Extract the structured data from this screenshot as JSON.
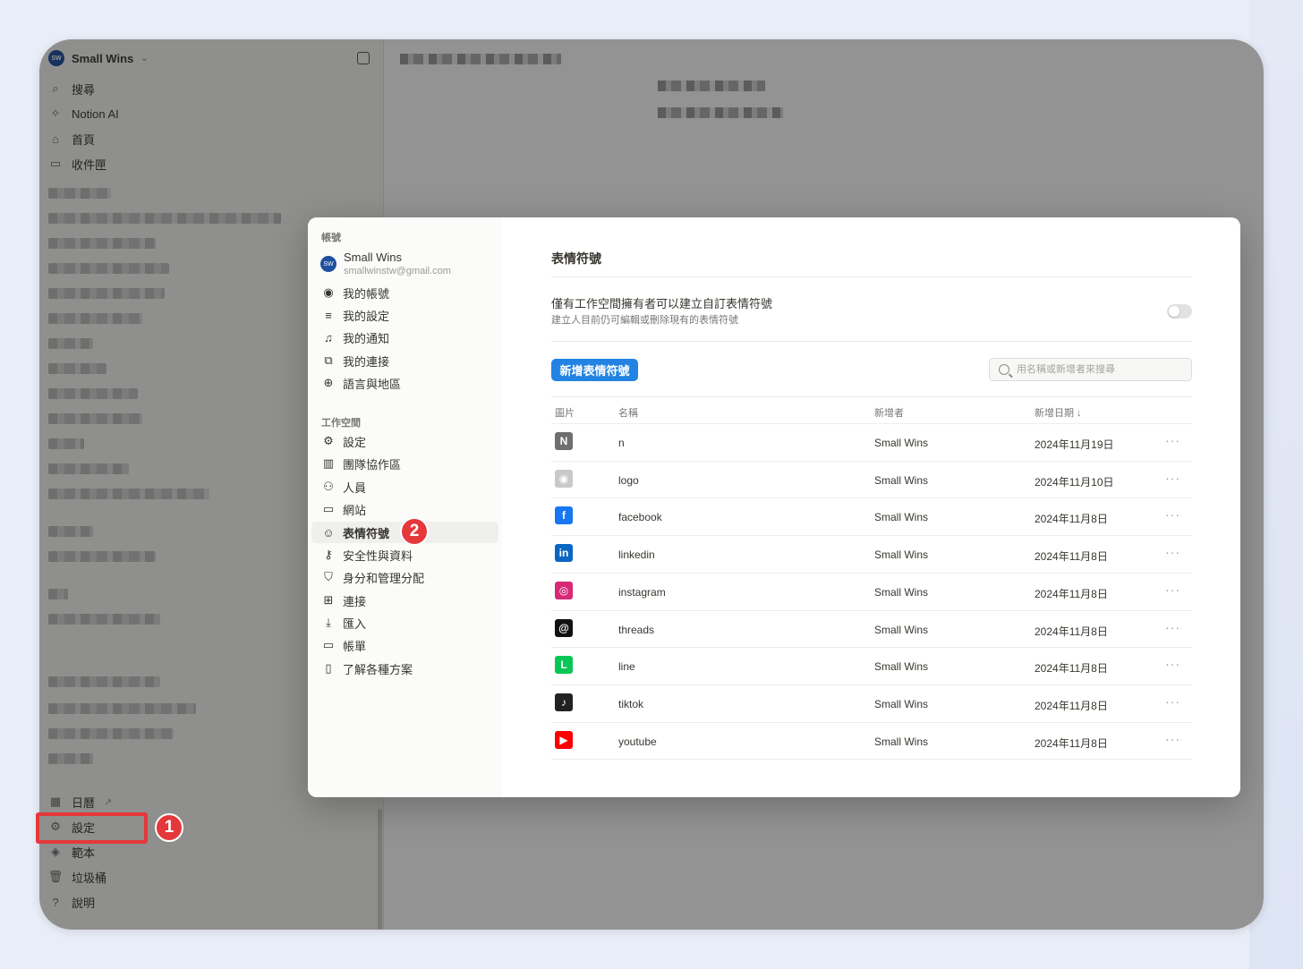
{
  "workspace": {
    "name": "Small Wins",
    "avatar_text": "SW"
  },
  "sidebar": {
    "top_items": [
      {
        "label": "搜尋",
        "icon": "search-icon"
      },
      {
        "label": "Notion AI",
        "icon": "notion-ai-icon"
      },
      {
        "label": "首頁",
        "icon": "home-icon"
      },
      {
        "label": "收件匣",
        "icon": "inbox-icon"
      }
    ],
    "bottom_items": [
      {
        "label": "日曆",
        "icon": "calendar-icon"
      },
      {
        "label": "設定",
        "icon": "gear-icon"
      },
      {
        "label": "範本",
        "icon": "template-icon"
      },
      {
        "label": "垃圾桶",
        "icon": "trash-icon"
      },
      {
        "label": "說明",
        "icon": "help-icon"
      }
    ],
    "calendar_arrow": "↗"
  },
  "annotations": {
    "step1": "1",
    "step2": "2"
  },
  "settings_modal": {
    "account_section": "帳號",
    "account": {
      "name": "Small Wins",
      "email": "smallwinstw@gmail.com"
    },
    "account_items": [
      {
        "label": "我的帳號",
        "icon": "user-circle-icon"
      },
      {
        "label": "我的設定",
        "icon": "sliders-icon"
      },
      {
        "label": "我的通知",
        "icon": "bell-icon"
      },
      {
        "label": "我的連接",
        "icon": "external-link-icon"
      },
      {
        "label": "語言與地區",
        "icon": "globe-icon"
      }
    ],
    "workspace_section": "工作空間",
    "workspace_items": [
      {
        "label": "設定",
        "icon": "gear-icon"
      },
      {
        "label": "團隊協作區",
        "icon": "building-icon"
      },
      {
        "label": "人員",
        "icon": "people-icon"
      },
      {
        "label": "網站",
        "icon": "website-icon"
      },
      {
        "label": "表情符號",
        "icon": "smiley-icon",
        "active": true
      },
      {
        "label": "安全性與資料",
        "icon": "key-icon"
      },
      {
        "label": "身分和管理分配",
        "icon": "shield-icon"
      },
      {
        "label": "連接",
        "icon": "grid-icon"
      },
      {
        "label": "匯入",
        "icon": "download-icon"
      },
      {
        "label": "帳單",
        "icon": "credit-card-icon"
      },
      {
        "label": "了解各種方案",
        "icon": "map-icon"
      }
    ],
    "content": {
      "title": "表情符號",
      "option_title": "僅有工作空間擁有者可以建立自訂表情符號",
      "option_subtitle": "建立人目前仍可編輯或刪除現有的表情符號",
      "toggle_on": false,
      "add_button": "新增表情符號",
      "search_placeholder": "用名稱或新增者來搜尋",
      "columns": {
        "image": "圖片",
        "name": "名稱",
        "creator": "新增者",
        "date": "新增日期 ↓"
      },
      "rows": [
        {
          "name": "n",
          "creator": "Small Wins",
          "date": "2024年11月19日",
          "icon": "notion-logo-icon",
          "color": "#6f6f6f",
          "glyph": "N"
        },
        {
          "name": "logo",
          "creator": "Small Wins",
          "date": "2024年11月10日",
          "icon": "brand-logo-icon",
          "color": "#c9c9c9",
          "glyph": "◉"
        },
        {
          "name": "facebook",
          "creator": "Small Wins",
          "date": "2024年11月8日",
          "icon": "facebook-icon",
          "color": "#1877f2",
          "glyph": "f"
        },
        {
          "name": "linkedin",
          "creator": "Small Wins",
          "date": "2024年11月8日",
          "icon": "linkedin-icon",
          "color": "#0a66c2",
          "glyph": "in"
        },
        {
          "name": "instagram",
          "creator": "Small Wins",
          "date": "2024年11月8日",
          "icon": "instagram-icon",
          "color": "#d62976",
          "glyph": "◎"
        },
        {
          "name": "threads",
          "creator": "Small Wins",
          "date": "2024年11月8日",
          "icon": "threads-icon",
          "color": "#111111",
          "glyph": "@"
        },
        {
          "name": "line",
          "creator": "Small Wins",
          "date": "2024年11月8日",
          "icon": "line-icon",
          "color": "#06c755",
          "glyph": "L"
        },
        {
          "name": "tiktok",
          "creator": "Small Wins",
          "date": "2024年11月8日",
          "icon": "tiktok-icon",
          "color": "#222222",
          "glyph": "♪"
        },
        {
          "name": "youtube",
          "creator": "Small Wins",
          "date": "2024年11月8日",
          "icon": "youtube-icon",
          "color": "#ff0000",
          "glyph": "▶"
        }
      ],
      "more_glyph": "···"
    }
  },
  "colors": {
    "accent": "#2383e2",
    "annotation_red": "#e5383b"
  }
}
